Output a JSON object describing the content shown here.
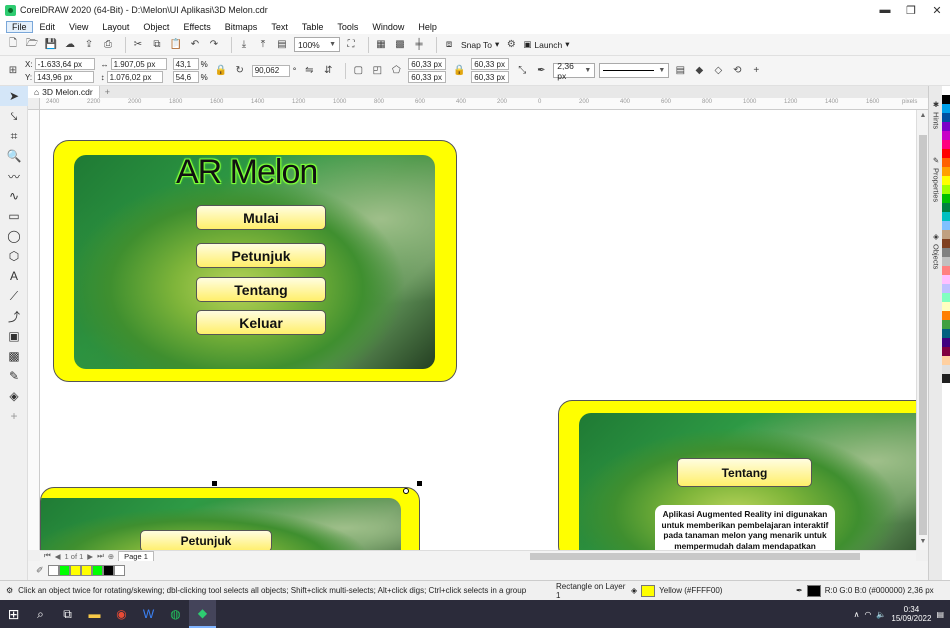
{
  "window": {
    "title": "CorelDRAW 2020 (64-Bit) - D:\\Melon\\UI Aplikasi\\3D Melon.cdr",
    "min_label": "▬",
    "restore_label": "❐",
    "close_label": "✕"
  },
  "menu": [
    "File",
    "Edit",
    "View",
    "Layout",
    "Object",
    "Effects",
    "Bitmaps",
    "Text",
    "Table",
    "Tools",
    "Window",
    "Help"
  ],
  "toolbar1": {
    "zoom": "100%",
    "snap_to": "Snap To",
    "launch": "Launch"
  },
  "property_bar": {
    "x": "-1.633,64 px",
    "y": "143,96 px",
    "width": "1.907,05 px",
    "height": "1.076,02 px",
    "scale_x": "43,1",
    "scale_y": "54,6",
    "percent": "%",
    "rotation": "90,062",
    "rotation_unit": "°",
    "corner_1": "60,33 px",
    "corner_2": "60,33 px",
    "corner_3": "60,33 px",
    "corner_4": "60,33 px",
    "outline_width": "2,36 px",
    "labels": {
      "x": "X:",
      "y": "Y:"
    }
  },
  "document": {
    "tab": "3D Melon.cdr"
  },
  "ruler": {
    "h_ticks": [
      "2400",
      "2200",
      "2000",
      "1800",
      "1600",
      "1400",
      "1200",
      "1000",
      "800",
      "600",
      "400",
      "200",
      "0",
      "200",
      "400",
      "600",
      "800",
      "1000",
      "1200",
      "1400",
      "1600"
    ],
    "h_unit": "pixels"
  },
  "design": {
    "main_title": "AR Melon",
    "buttons": [
      "Mulai",
      "Petunjuk",
      "Tentang",
      "Keluar"
    ],
    "second_button": "Petunjuk",
    "about_title": "Tentang",
    "about_text": "Aplikasi Augmented Reality ini digunakan untuk memberikan pembelajaran interaktif pada tanaman melon yang menarik untuk mempermudah dalam mendapatkan"
  },
  "dockers": [
    "Hints",
    "Properties",
    "Objects"
  ],
  "pagebar": {
    "nav": "1 of 1",
    "page_tab": "Page 1"
  },
  "status": {
    "hint": "Click an object twice for rotating/skewing; dbl-clicking tool selects all objects; Shift+click multi-selects; Alt+click digs; Ctrl+click selects in a group",
    "object": "Rectangle on Layer 1",
    "fill": "Yellow (#FFFF00)",
    "stroke": "R:0 G:0 B:0 (#000000)  2,36 px"
  },
  "taskbar": {
    "time": "0:34",
    "date": "15/09/2022"
  },
  "colors": {
    "fill": "#FFFF00",
    "stroke": "#000000",
    "palette": [
      "#ffffff",
      "#000000",
      "#00a0e9",
      "#0050a0",
      "#7a00c8",
      "#c800c8",
      "#ff0080",
      "#ff0000",
      "#ff6000",
      "#ffa000",
      "#ffff00",
      "#a0ff00",
      "#00c000",
      "#008040",
      "#00c0c0",
      "#80c0ff",
      "#c0a080",
      "#804020",
      "#808080",
      "#c0c0c0",
      "#ff8080",
      "#ffc0ff",
      "#c0c0ff",
      "#80ffc0",
      "#ffffc0",
      "#ff8000",
      "#40a040",
      "#006080",
      "#400080",
      "#800040",
      "#ffd0a0",
      "#e0e0e0",
      "#202020"
    ],
    "doc_palette": [
      "#ffffff",
      "#00ff00",
      "#ffff00",
      "#ffff00",
      "#00ff00",
      "#000000",
      "#ffffff"
    ]
  }
}
